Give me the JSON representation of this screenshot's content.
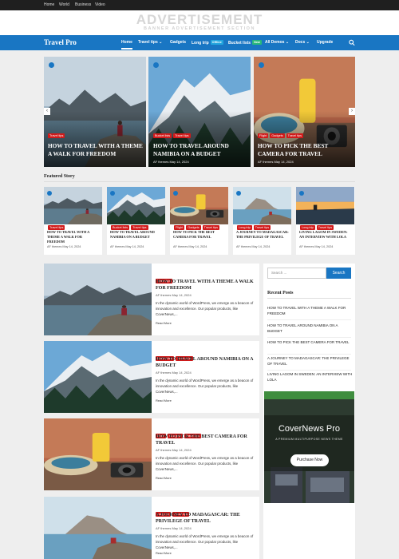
{
  "topbar": {
    "links": [
      "Home",
      "World",
      "Business",
      "Video"
    ]
  },
  "ad": {
    "title": "ADVERTISEMENT",
    "subtitle": "BANNER ADVERTISEMENT SECTION"
  },
  "nav": {
    "logo": "Travel Pro",
    "items": [
      "Home",
      "Travel tips",
      "Gadgets",
      "Long trip",
      "Bucket lists",
      "All Demos",
      "Docs",
      "Upgrade"
    ],
    "badges": {
      "long_trip": "Offline",
      "bucket_lists": "New"
    },
    "colors": {
      "primary": "#1976c3",
      "badge_long_trip": "#23a5dd",
      "badge_bucket": "#29b87a"
    }
  },
  "hero": [
    {
      "cats": [
        "Travel tips"
      ],
      "title": "HOW TO TRAVEL WITH A THEME A WALK FOR FREEDOM",
      "meta": ""
    },
    {
      "cats": [
        "Bucket lists",
        "Travel tips"
      ],
      "title": "HOW TO TRAVEL AROUND NAMIBIA ON A BUDGET",
      "meta": "AF themes   May 14, 2024"
    },
    {
      "cats": [
        "Flight",
        "Gadgets",
        "Travel tips"
      ],
      "title": "HOW TO PICK THE BEST CAMERA FOR TRAVEL",
      "meta": "AF themes   May 14, 2024"
    }
  ],
  "featured": {
    "heading": "Featured Story",
    "cards": [
      {
        "cats": [
          "Travel tips"
        ],
        "title": "HOW TO TRAVEL WITH A THEME A WALK FOR FREEDOM",
        "meta": "AF themes   May 14, 2024"
      },
      {
        "cats": [
          "Bucket lists",
          "Travel tips"
        ],
        "title": "HOW TO TRAVEL AROUND NAMIBIA ON A BUDGET",
        "meta": "AF themes   May 14, 2024"
      },
      {
        "cats": [
          "Flight",
          "Gadgets",
          "Travel tips"
        ],
        "title": "HOW TO PICK THE BEST CAMERA FOR TRAVEL",
        "meta": "AF themes   May 14, 2024"
      },
      {
        "cats": [
          "Long trip",
          "Travel tips"
        ],
        "title": "A JOURNEY TO MADAGASCAR: THE PRIVILEGE OF TRAVEL",
        "meta": "AF themes   May 14, 2024"
      },
      {
        "cats": [
          "Long trip",
          "Travel tips"
        ],
        "title": "LIVING LAGOM IN SWEDEN: AN INTERVIEW WITH LOLA",
        "meta": "AF themes   May 14, 2024"
      }
    ]
  },
  "posts": [
    {
      "cats": [
        "Travel tips"
      ],
      "title": "HOW TO TRAVEL WITH A THEME A WALK FOR FREEDOM",
      "meta": "AF themes   May 14, 2024",
      "excerpt": "In the dynamic world of WordPress, we emerge as a beacon of innovation and excellence. Our popular products, like CoverNews,...",
      "more": "Read More"
    },
    {
      "cats": [
        "Bucket lists",
        "Travel tips"
      ],
      "title": "HOW TO TRAVEL AROUND NAMIBIA ON A BUDGET",
      "meta": "AF themes   May 14, 2024",
      "excerpt": "In the dynamic world of WordPress, we emerge as a beacon of innovation and excellence. Our popular products, like CoverNews,...",
      "more": "Read More"
    },
    {
      "cats": [
        "Flight",
        "Gadgets",
        "Travel tips"
      ],
      "title": "HOW TO PICK THE BEST CAMERA FOR TRAVEL",
      "meta": "AF themes   May 14, 2024",
      "excerpt": "In the dynamic world of WordPress, we emerge as a beacon of innovation and excellence. Our popular products, like CoverNews,...",
      "more": "Read More"
    },
    {
      "cats": [
        "Long trip",
        "Travel tips"
      ],
      "title": "A JOURNEY TO MADAGASCAR: THE PRIVILEGE OF TRAVEL",
      "meta": "AF themes   May 14, 2024",
      "excerpt": "In the dynamic world of WordPress, we emerge as a beacon of innovation and excellence. Our popular products, like CoverNews,...",
      "more": "Read More"
    }
  ],
  "sidebar": {
    "search_placeholder": "Search ...",
    "search_button": "Search",
    "recent_heading": "Recent Posts",
    "recent": [
      "HOW TO TRAVEL WITH A THEME A WALK FOR FREEDOM",
      "HOW TO TRAVEL AROUND NAMIBIA ON A BUDGET",
      "HOW TO PICK THE BEST CAMERA FOR TRAVEL",
      "A JOURNEY TO MADAGASCAR: THE PRIVILEGE OF TRAVEL",
      "LIVING LAGOM IN SWEDEN: AN INTERVIEW WITH LOLA"
    ],
    "promo": {
      "title": "CoverNews Pro",
      "subtitle": "A PREMIUM MULTIPURPOSE NEWS THEME",
      "button": "Purchase Now"
    }
  }
}
